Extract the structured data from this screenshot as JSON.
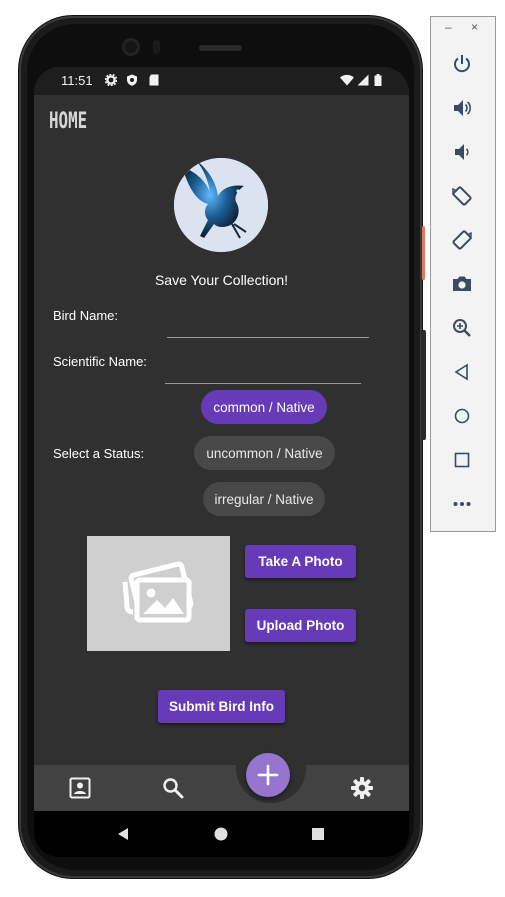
{
  "statusbar": {
    "time": "11:51"
  },
  "appbar": {
    "title": "HOME"
  },
  "form": {
    "heading": "Save Your Collection!",
    "bird_name_label": "Bird Name:",
    "bird_name_value": "",
    "scientific_name_label": "Scientific Name:",
    "scientific_name_value": "",
    "status_label": "Select a Status:",
    "status_options": [
      {
        "label": "common / Native",
        "selected": true
      },
      {
        "label": "uncommon / Native",
        "selected": false
      },
      {
        "label": "irregular / Native",
        "selected": false
      }
    ],
    "take_photo": "Take A Photo",
    "upload_photo": "Upload Photo",
    "submit": "Submit Bird Info"
  },
  "bottom_nav": {
    "items": [
      "contact-icon",
      "search-icon",
      "add-icon",
      "settings-icon"
    ]
  },
  "colors": {
    "accent": "#673ab7",
    "fab": "#9575cd",
    "background": "#303030",
    "nav": "#424242"
  },
  "emulator": {
    "window_controls": [
      "–",
      "×"
    ],
    "tools": [
      "power-icon",
      "volume-up-icon",
      "volume-down-icon",
      "rotate-left-icon",
      "rotate-right-icon",
      "camera-icon",
      "zoom-icon",
      "back-icon",
      "home-icon",
      "overview-icon",
      "more-icon"
    ]
  }
}
